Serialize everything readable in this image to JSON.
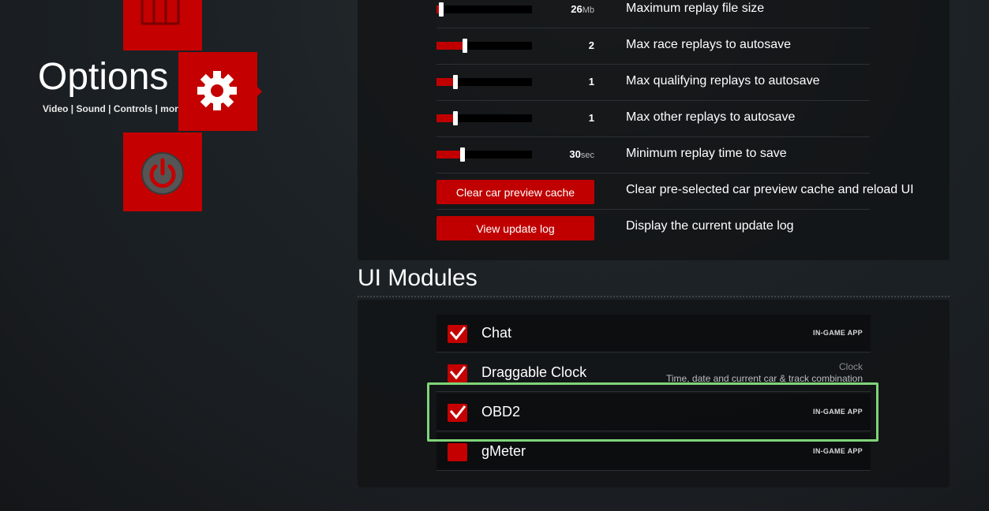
{
  "nav": {
    "title": "Options",
    "subtitle": "Video | Sound | Controls | more",
    "icons": [
      "module-icon",
      "gear-icon",
      "power-icon"
    ]
  },
  "replays": [
    {
      "value": "26",
      "unit": "Mb",
      "label": "Maximum replay file size",
      "level": 0.05
    },
    {
      "value": "2",
      "unit": "",
      "label": "Max race replays to autosave",
      "level": 0.3
    },
    {
      "value": "1",
      "unit": "",
      "label": "Max qualifying replays to autosave",
      "level": 0.2
    },
    {
      "value": "1",
      "unit": "",
      "label": "Max other replays to autosave",
      "level": 0.2
    },
    {
      "value": "30",
      "unit": "sec",
      "label": "Minimum replay time to save",
      "level": 0.27
    }
  ],
  "actions": [
    {
      "button": "Clear car preview cache",
      "label": "Clear pre-selected car preview cache and reload UI"
    },
    {
      "button": "View update log",
      "label": "Display the current update log"
    }
  ],
  "modules_section": {
    "title": "UI Modules"
  },
  "modules": [
    {
      "name": "Chat",
      "tag": "IN-GAME APP",
      "checked": true
    },
    {
      "name": "Draggable Clock",
      "kind": "Clock",
      "desc": "Time, date and current car & track combination",
      "checked": true
    },
    {
      "name": "OBD2",
      "tag": "IN-GAME APP",
      "checked": true
    },
    {
      "name": "gMeter",
      "tag": "IN-GAME APP",
      "checked": false
    }
  ],
  "colors": {
    "accent": "#c40000",
    "highlight": "#7fd47a"
  }
}
